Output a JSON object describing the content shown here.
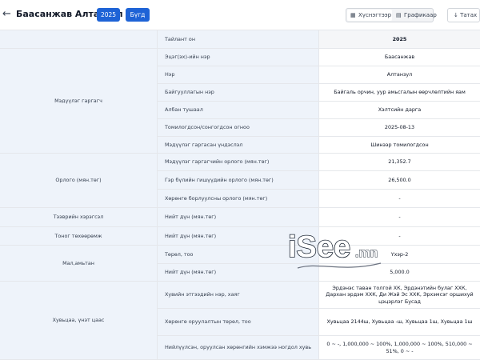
{
  "header": {
    "title": "Баасанжав Алтанзул",
    "year_button": "2025",
    "all_button": "Бүгд",
    "table_view": "Хүснэгтээр",
    "chart_view": "Графикаар",
    "download": "Татах"
  },
  "rows": {
    "r0": {
      "label": "Тайлант он",
      "value": "2025"
    },
    "g1": "Мэдүүлэг гаргагч",
    "r1": {
      "label": "Эцэг(эх)-ийн нэр",
      "value": "Баасанжав"
    },
    "r2": {
      "label": "Нэр",
      "value": "Алтанзул"
    },
    "r3": {
      "label": "Байгууллагын нэр",
      "value": "Байгаль орчин, уур амьсгалын өөрчлөлтийн яам"
    },
    "r4": {
      "label": "Албан тушаал",
      "value": "Хэлтсийн дарга"
    },
    "r5": {
      "label": "Томилогдсон/сонгогдсон огноо",
      "value": "2025-08-13"
    },
    "r6": {
      "label": "Мэдүүлэг гаргасан үндэслэл",
      "value": "Шинээр томилогдсон"
    },
    "g2": "Орлого (мян.төг)",
    "r7": {
      "label": "Мэдүүлэг гаргагчийн орлого (мян.төг)",
      "value": "21,352.7"
    },
    "r8": {
      "label": "Гэр бүлийн гишүүдийн орлого (мян.төг)",
      "value": "26,500.0"
    },
    "r9": {
      "label": "Хөрөнгө борлуулсны орлого (мян.төг)",
      "value": "-"
    },
    "g3": "Тээврийн хэрэгсэл",
    "r10": {
      "label": "Нийт дүн (мян.төг)",
      "value": "-"
    },
    "g4": "Тоног төхөөрөмж",
    "r11": {
      "label": "Нийт дүн (мян.төг)",
      "value": "-"
    },
    "g5": "Мал,амьтан",
    "r12": {
      "label": "Төрөл, тоо",
      "value": "Үхэр-2"
    },
    "r13": {
      "label": "Нийт дүн (мян.төг)",
      "value": "5,000.0"
    },
    "g6": "Хувьцаа, үнэт цаас",
    "r14": {
      "label": "Хувийн этгээдийн нэр, хаяг",
      "value": "Эрдэнэс таван толгой ХК, Эрдэнэтийн булаг ХХК, Дархан эрдэм ХХК, Ди Жэй Эс ХХК, Эрхэмсэг оршихуй цэцэрлэг Бусад"
    },
    "r15": {
      "label": "Хөрөнгө оруулалтын төрөл, тоо",
      "value": "Хувьцаа 2144ш, Хувьцаа -ш, Хувьцаа 1ш, Хувьцаа 1ш"
    },
    "r16": {
      "label": "Нийлүүлсэн, оруулсан хөрөнгийн хэмжээ ногдол хувь",
      "value": "0 ~ -, 1,000,000 ~ 100%, 1,000,000 ~ 100%, 510,000 ~ 51%, 0 ~ -"
    }
  },
  "watermark": {
    "brand": "iSee.mn"
  },
  "colors": {
    "accent": "#1e63d6",
    "label_bg": "#eef3fa",
    "border": "#e5e7eb"
  }
}
